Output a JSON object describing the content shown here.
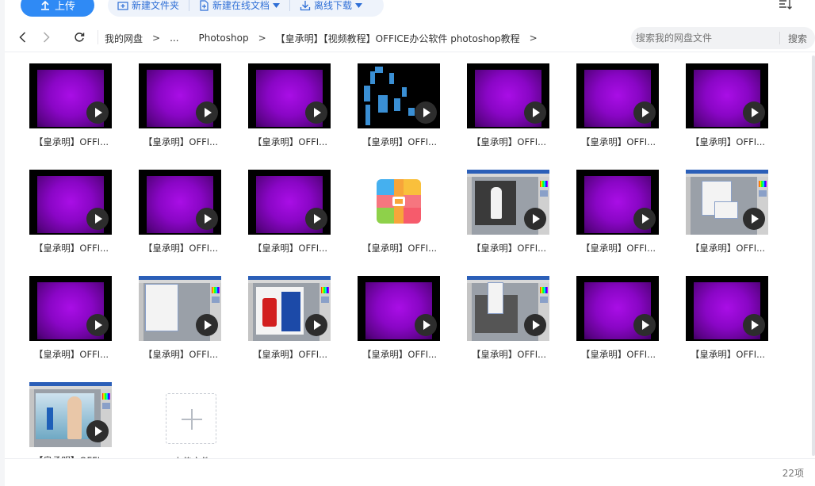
{
  "toolbar": {
    "upload_label": "上传",
    "new_folder_label": "新建文件夹",
    "new_online_doc_label": "新建在线文档",
    "offline_download_label": "离线下载"
  },
  "breadcrumb": {
    "items": [
      "我的网盘",
      "...",
      "Photoshop",
      "【皇承明】【视频教程】OFFICE办公软件  photoshop教程"
    ],
    "separator": ">"
  },
  "search": {
    "placeholder": "搜索我的网盘文件",
    "button_label": "搜索"
  },
  "files": [
    {
      "name": "【皇承明】OFFI...",
      "thumb": "purple",
      "video": true
    },
    {
      "name": "【皇承明】OFFI...",
      "thumb": "purple",
      "video": true
    },
    {
      "name": "【皇承明】OFFI...",
      "thumb": "purple",
      "video": true
    },
    {
      "name": "【皇承明】OFFI...",
      "thumb": "blocks",
      "video": true
    },
    {
      "name": "【皇承明】OFFI...",
      "thumb": "purple",
      "video": true
    },
    {
      "name": "【皇承明】OFFI...",
      "thumb": "purple",
      "video": true
    },
    {
      "name": "【皇承明】OFFI...",
      "thumb": "purple",
      "video": true
    },
    {
      "name": "【皇承明】OFFI...",
      "thumb": "purple",
      "video": true
    },
    {
      "name": "【皇承明】OFFI...",
      "thumb": "purple",
      "video": true
    },
    {
      "name": "【皇承明】OFFI...",
      "thumb": "purple",
      "video": true
    },
    {
      "name": "【皇承明】OFFI...",
      "thumb": "zip",
      "video": false
    },
    {
      "name": "【皇承明】OFFI...",
      "thumb": "screen-bride",
      "video": true
    },
    {
      "name": "【皇承明】OFFI...",
      "thumb": "purple",
      "video": true
    },
    {
      "name": "【皇承明】OFFI...",
      "thumb": "screen-dialog",
      "video": true
    },
    {
      "name": "【皇承明】OFFI...",
      "thumb": "purple",
      "video": true
    },
    {
      "name": "【皇承明】OFFI...",
      "thumb": "screen-dialog2",
      "video": true
    },
    {
      "name": "【皇承明】OFFI...",
      "thumb": "screen-can",
      "video": true
    },
    {
      "name": "【皇承明】OFFI...",
      "thumb": "purple",
      "video": true
    },
    {
      "name": "【皇承明】OFFI...",
      "thumb": "screen-menu",
      "video": true
    },
    {
      "name": "【皇承明】OFFI...",
      "thumb": "purple",
      "video": true
    },
    {
      "name": "【皇承明】OFFI...",
      "thumb": "purple",
      "video": true
    },
    {
      "name": "【皇承明】OFFI...",
      "thumb": "screen-girl",
      "video": true
    }
  ],
  "upload_tile_label": "上传文件",
  "footer": {
    "count_label": "22项"
  },
  "colors": {
    "accent": "#2f8af5",
    "purple": "#9a09d6"
  }
}
